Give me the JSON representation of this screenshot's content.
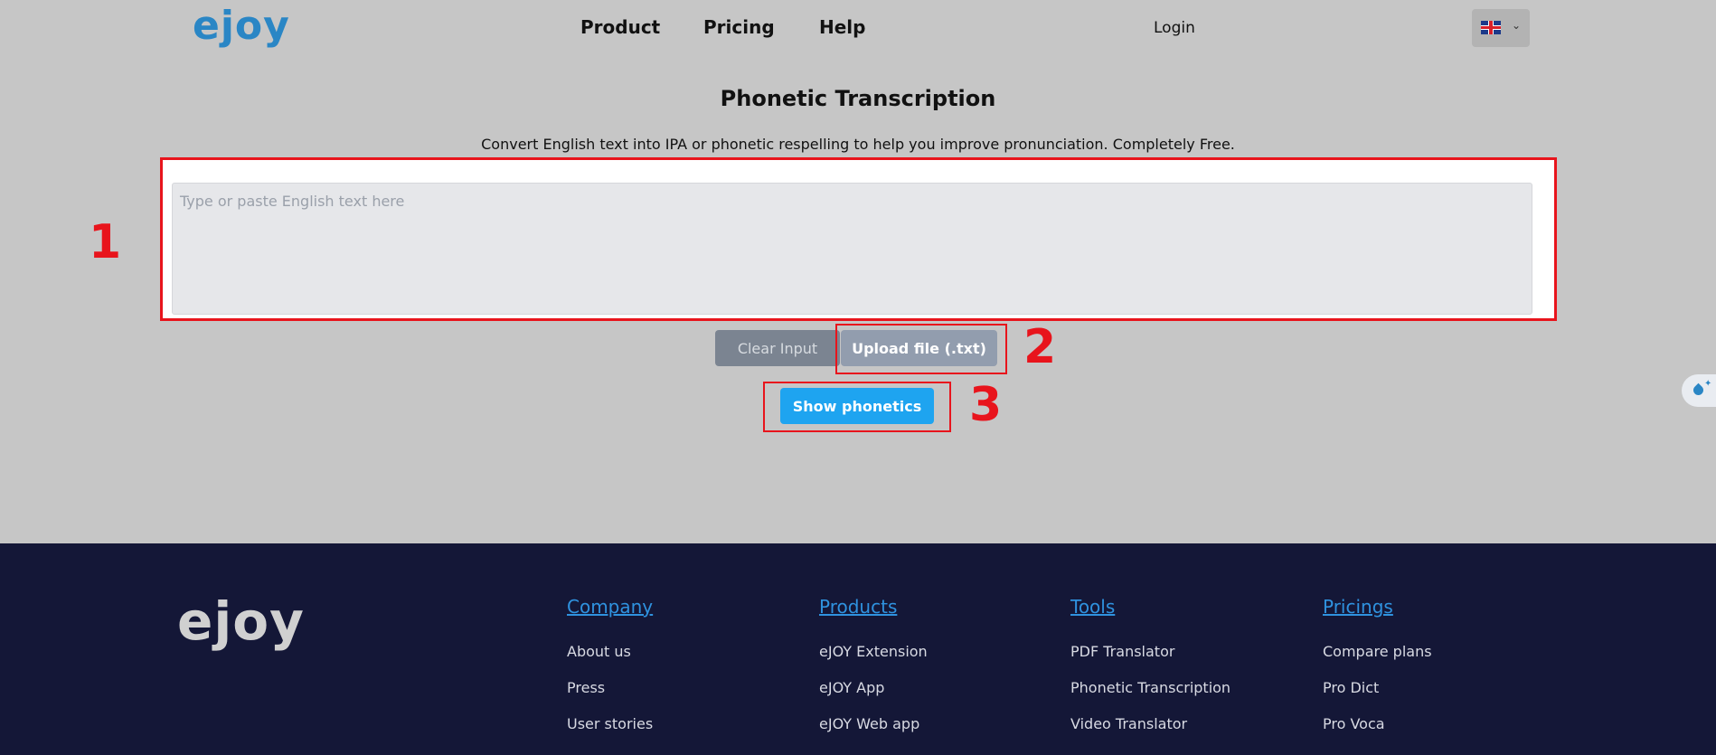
{
  "header": {
    "logo": "ejoy",
    "nav": [
      {
        "label": "Product"
      },
      {
        "label": "Pricing"
      },
      {
        "label": "Help"
      }
    ],
    "login_label": "Login"
  },
  "main": {
    "title": "Phonetic Transcription",
    "subtitle": "Convert English text into IPA or phonetic respelling to help you improve pronunciation. Completely Free.",
    "input_placeholder": "Type or paste English text here",
    "input_value": "",
    "clear_label": "Clear Input",
    "upload_label": "Upload file (.txt)",
    "show_label": "Show phonetics"
  },
  "markers": [
    "1",
    "2",
    "3"
  ],
  "footer": {
    "logo": "ejoy",
    "columns": [
      {
        "heading": "Company",
        "links": [
          "About us",
          "Press",
          "User stories"
        ]
      },
      {
        "heading": "Products",
        "links": [
          "eJOY Extension",
          "eJOY App",
          "eJOY Web app"
        ]
      },
      {
        "heading": "Tools",
        "links": [
          "PDF Translator",
          "Phonetic Transcription",
          "Video Translator"
        ]
      },
      {
        "heading": "Pricings",
        "links": [
          "Compare plans",
          "Pro Dict",
          "Pro Voca"
        ]
      }
    ]
  },
  "colors": {
    "accent": "#1ea4f0",
    "annotation": "#e8141c",
    "footer_bg": "#141737",
    "footer_heading": "#2f92df"
  },
  "icons": {
    "language": "uk-flag-icon",
    "dropdown": "chevron-down-icon",
    "side_widget": "ejoy-drop-icon"
  }
}
